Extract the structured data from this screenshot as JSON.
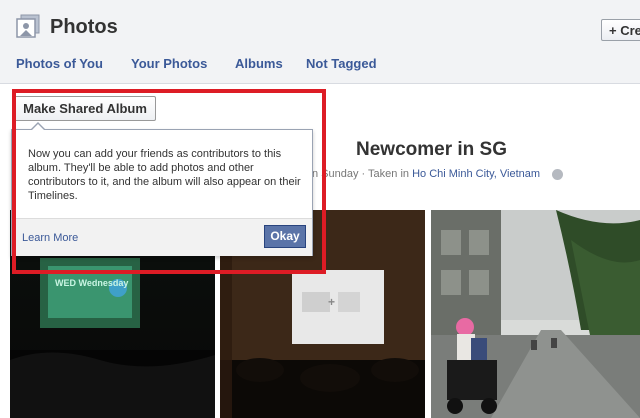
{
  "header": {
    "title": "Photos",
    "create_label": "+ Cre",
    "tabs": [
      {
        "label": "Photos of You"
      },
      {
        "label": "Your Photos"
      },
      {
        "label": "Albums"
      },
      {
        "label": "Not Tagged"
      }
    ]
  },
  "album": {
    "title": "Newcomer in SG",
    "meta_prefix": "n Sunday · Taken in ",
    "meta_location": "Ho Chi Minh City, Vietnam"
  },
  "tooltip": {
    "button_label": "Make Shared Album",
    "body": "Now you can add your friends as contributors to this album. They'll be able to add photos and other contributors to it, and the album will also appear on their Timelines.",
    "learn_more": "Learn More",
    "okay": "Okay"
  },
  "photos": [
    {
      "caption_text": "WED Wednesday"
    },
    {
      "caption_text": ""
    },
    {
      "caption_text": ""
    }
  ],
  "colors": {
    "link": "#3b5998",
    "highlight": "#dd1c25",
    "okay_button": "#5b74a8"
  }
}
